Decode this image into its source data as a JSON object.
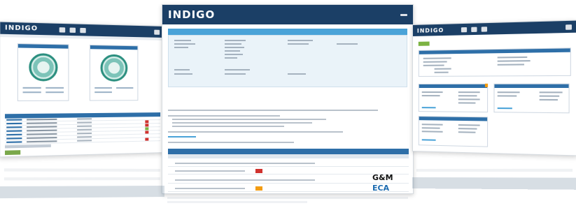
{
  "left": {
    "logo": "INDIGO"
  },
  "center": {
    "logo": "INDIGO",
    "brand1": "G&M",
    "brand2": "ECA"
  },
  "right": {
    "logo": "INDIGO"
  },
  "colors": {
    "header": "#1b3f66",
    "accent": "#2e6fa8",
    "panel_blue": "#4aa3d8",
    "green": "#7cb342",
    "red": "#d0312d",
    "orange": "#f39c12",
    "teal": "#2b8f7f"
  }
}
